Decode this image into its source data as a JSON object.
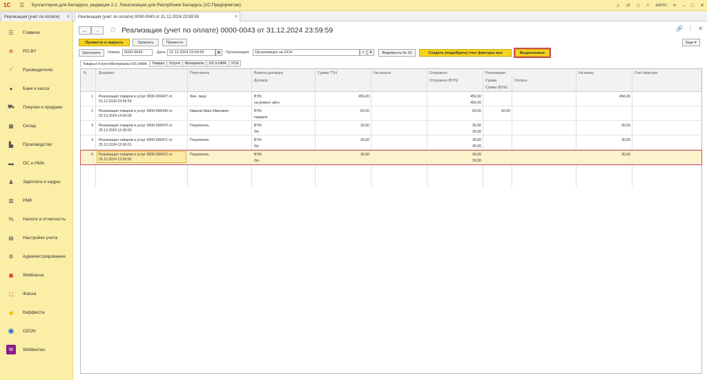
{
  "titlebar": {
    "logo": "1С",
    "app_title": "Бухгалтерия для Беларуси, редакция 2.1. Локализация для Республики Беларусь  (1С:Предприятие)",
    "user": "admin"
  },
  "tabs": [
    {
      "label": "Реализация (учет по оплате)"
    },
    {
      "label": "Реализация (учет по оплате) 0000-0043 от 31.12.2024 23:59:59"
    }
  ],
  "sidebar": {
    "items": [
      {
        "label": "Главное",
        "icon": "menu-icon"
      },
      {
        "label": "PO.BY",
        "icon": "po-by-icon"
      },
      {
        "label": "Руководителю",
        "icon": "chart-line-icon"
      },
      {
        "label": "Банк и касса",
        "icon": "bank-icon"
      },
      {
        "label": "Покупки и продажи",
        "icon": "cart-icon"
      },
      {
        "label": "Склад",
        "icon": "warehouse-icon"
      },
      {
        "label": "Производство",
        "icon": "factory-icon"
      },
      {
        "label": "ОС и НМА",
        "icon": "truck-icon"
      },
      {
        "label": "Зарплата и кадры",
        "icon": "person-icon"
      },
      {
        "label": "РМК",
        "icon": "cash-register-icon"
      },
      {
        "label": "Налоги и отчетность",
        "icon": "tax-icon"
      },
      {
        "label": "Настройки учета",
        "icon": "books-icon"
      },
      {
        "label": "Администрирование",
        "icon": "gear-icon"
      },
      {
        "label": "Webkassa",
        "icon": "webkassa-icon"
      },
      {
        "label": "iKassa",
        "icon": "ikassa-icon"
      },
      {
        "label": "Каффеста",
        "icon": "kaffesta-icon"
      },
      {
        "label": "OZON",
        "icon": "ozon-icon"
      },
      {
        "label": "Wildberries",
        "icon": "wildberries-icon"
      }
    ]
  },
  "document": {
    "title": "Реализация (учет по оплате) 0000-0043 от 31.12.2024 23:59:59",
    "btn_post_close": "Провести и закрыть",
    "btn_save": "Записать",
    "btn_post": "Провести",
    "btn_more": "Еще",
    "btn_fill": "Заполнить",
    "number_label": "Номер:",
    "number_value": "0000-0043",
    "date_label": "Дата:",
    "date_value": "31.12.2024 23:59:59",
    "org_label": "Организация:",
    "org_value": "Организация на ОСН",
    "btn_statement": "Ведомость № 16",
    "btn_create_invoice": "Создать (подобрать) счет фактуры все",
    "btn_selected": "Выделенные"
  },
  "inner_tabs": [
    "Товары+Услуги+Материалы+ОС+НМА",
    "Товары",
    "Услуги",
    "Материалы",
    "ОС и НМА",
    "УСН"
  ],
  "table": {
    "headers": {
      "n": "N",
      "doc": "Документ",
      "recipient": "Получатель",
      "currency": "Валюта договора",
      "contract": "Договор",
      "sum_ttn": "Сумма ТТН",
      "start": "На начало",
      "shipped": "Отгружено",
      "shipped_byn": "Отгружено (BYN)",
      "realization": "Реализация",
      "sum": "Сумма",
      "sum_byn": "Сумма (BYN)",
      "payments": "Оплаты",
      "end": "На конец",
      "invoice": "Счет фактура"
    },
    "rows": [
      {
        "n": "1",
        "doc1": "Реализация товаров и услуг 0000-000407 от",
        "doc2": "01.12.2024 23:59:59",
        "recipient": "Физ. лицо",
        "currency": "BYN",
        "contract": "на ремонт авто",
        "sum_ttn": "456,00",
        "start": "",
        "shipped": "456,00",
        "shipped_byn": "456,00",
        "sum": "",
        "end": "456,00"
      },
      {
        "n": "2",
        "doc1": "Реализация товаров и услуг 0000-000440 от",
        "doc2": "02.12.2024 14:00:05",
        "recipient": "Иванов Иван Иванович",
        "currency": "BYN",
        "contract": "подарок",
        "sum_ttn": "60,00",
        "start": "",
        "shipped": "60,00",
        "shipped_byn": "",
        "sum": "60,00",
        "end": ""
      },
      {
        "n": "3",
        "doc1": "Реализация товаров и услуг 0000-000470 от",
        "doc2": "25.12.2024 12:00:00",
        "recipient": "Покупатель",
        "currency": "BYN",
        "contract": "б/н",
        "sum_ttn": "30,00",
        "start": "",
        "shipped": "30,00",
        "shipped_byn": "30,00",
        "sum": "",
        "end": "30,00"
      },
      {
        "n": "4",
        "doc1": "Реализация товаров и услуг 0000-000471 от",
        "doc2": "25.12.2024 12:00:01",
        "recipient": "Покупатель",
        "currency": "BYN",
        "contract": "б/н",
        "sum_ttn": "30,00",
        "start": "",
        "shipped": "30,00",
        "shipped_byn": "30,00",
        "sum": "",
        "end": "30,00"
      },
      {
        "n": "5",
        "doc1": "Реализация товаров и услуг 0000-000472 от",
        "doc2": "25.12.2024 12:00:02",
        "recipient": "Покупатель",
        "currency": "BYN",
        "contract": "б/н",
        "sum_ttn": "30,00",
        "start": "",
        "shipped": "30,00",
        "shipped_byn": "30,00",
        "sum": "",
        "end": "30,00"
      }
    ]
  }
}
